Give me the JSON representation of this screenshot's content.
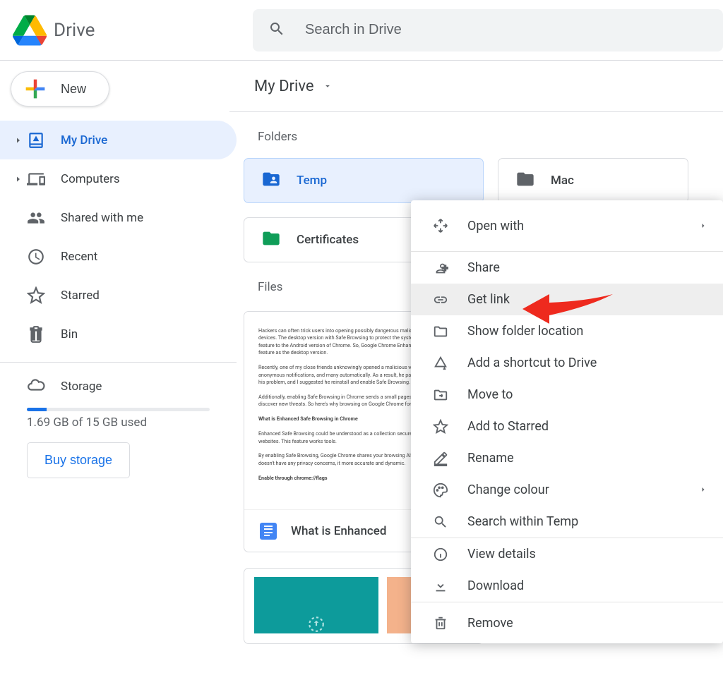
{
  "header": {
    "app_title": "Drive",
    "search_placeholder": "Search in Drive"
  },
  "sidebar": {
    "new_label": "New",
    "items": [
      {
        "label": "My Drive"
      },
      {
        "label": "Computers"
      },
      {
        "label": "Shared with me"
      },
      {
        "label": "Recent"
      },
      {
        "label": "Starred"
      },
      {
        "label": "Bin"
      }
    ],
    "storage_label": "Storage",
    "storage_used": "1.69 GB of 15 GB used",
    "buy_label": "Buy storage"
  },
  "main": {
    "breadcrumb": "My Drive",
    "folders_label": "Folders",
    "files_label": "Files",
    "folders": [
      {
        "name": "Temp"
      },
      {
        "name": "Mac"
      },
      {
        "name": "Certificates"
      }
    ],
    "file1_name": "What is Enhanced",
    "preview": {
      "p1": "Hackers can often trick users into opening possibly dangerous malicious software onto their devices. The desktop version with Safe Browsing to protect the systems from such malware feature to the Android version of Chrome. So, Google Chrome Enhanced Safe Browsing feature as the desktop version.",
      "p2": "Recently, one of my close friends unknowingly opened a malicious web. He then received anonymous notifications, and many automatically. As a result, he panicked and switched off his problem, and I suggested he reinstall and enable Safe Browsing.",
      "p3": "Additionally, enabling Safe Browsing in Chrome sends a small pages and downloads to discover new threats. So here's why browsing on Google Chrome for Android.",
      "h1": "What is Enhanced Safe Browsing in Chrome",
      "p4": "Enhanced Safe Browsing could be understood as a collection secure users' data from unsafe websites. This feature works tools.",
      "p5": "By enabling Safe Browsing, Google Chrome shares your browsing Although this feature doesn't have any privacy concerns, it more accurate and dynamic.",
      "h2": "Enable through chrome://flags"
    }
  },
  "menu": {
    "open_with": "Open with",
    "share": "Share",
    "get_link": "Get link",
    "show_loc": "Show folder location",
    "shortcut": "Add a shortcut to Drive",
    "move_to": "Move to",
    "starred": "Add to Starred",
    "rename": "Rename",
    "colour": "Change colour",
    "search_within": "Search within Temp",
    "view_details": "View details",
    "download": "Download",
    "remove": "Remove"
  }
}
